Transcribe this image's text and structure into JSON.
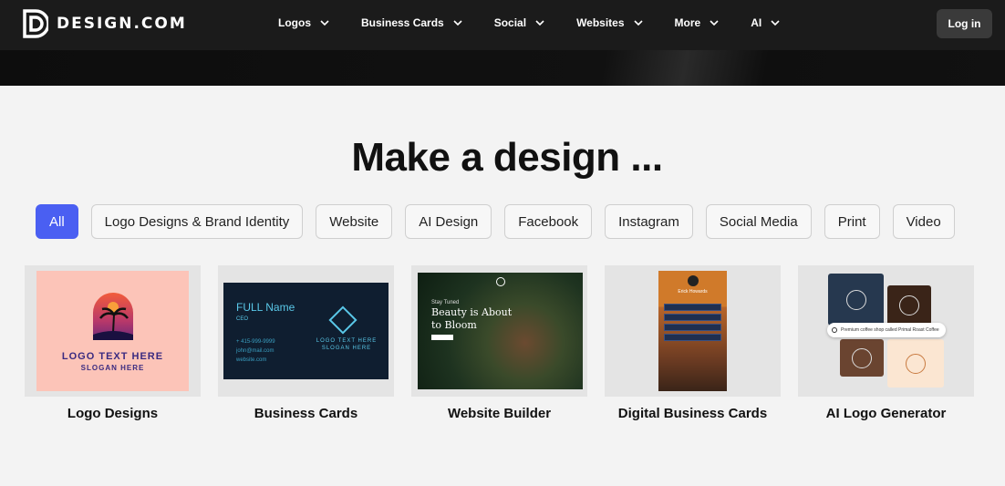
{
  "brand": {
    "name": "DESIGN.COM"
  },
  "nav": {
    "items": [
      {
        "label": "Logos"
      },
      {
        "label": "Business Cards"
      },
      {
        "label": "Social"
      },
      {
        "label": "Websites"
      },
      {
        "label": "More"
      },
      {
        "label": "AI"
      }
    ],
    "login_label": "Log in"
  },
  "main": {
    "heading": "Make a design ...",
    "filters": [
      {
        "label": "All",
        "selected": true
      },
      {
        "label": "Logo Designs & Brand Identity",
        "selected": false
      },
      {
        "label": "Website",
        "selected": false
      },
      {
        "label": "AI Design",
        "selected": false
      },
      {
        "label": "Facebook",
        "selected": false
      },
      {
        "label": "Instagram",
        "selected": false
      },
      {
        "label": "Social Media",
        "selected": false
      },
      {
        "label": "Print",
        "selected": false
      },
      {
        "label": "Video",
        "selected": false
      }
    ],
    "cards": [
      {
        "label": "Logo Designs",
        "thumb": {
          "logo_text": "LOGO TEXT HERE",
          "slogan": "SLOGAN HERE"
        }
      },
      {
        "label": "Business Cards",
        "thumb": {
          "name": "FULL Name",
          "role": "CEO",
          "phone": "+ 415-999-9999",
          "email": "john@mail.com",
          "site": "website.com",
          "logo_text": "LOGO TEXT HERE",
          "slogan": "SLOGAN HERE"
        }
      },
      {
        "label": "Website Builder",
        "thumb": {
          "kicker": "Stay Tuned",
          "headline": "Beauty is About to Bloom"
        }
      },
      {
        "label": "Digital Business Cards",
        "thumb": {
          "name": "Erick Howards"
        }
      },
      {
        "label": "AI Logo Generator",
        "thumb": {
          "prompt": "Premium coffee shop called Primal Roast Coffee"
        }
      }
    ]
  },
  "colors": {
    "accent": "#4a5ff2",
    "topbar": "#1b1b1b",
    "page": "#f3f3f3"
  }
}
